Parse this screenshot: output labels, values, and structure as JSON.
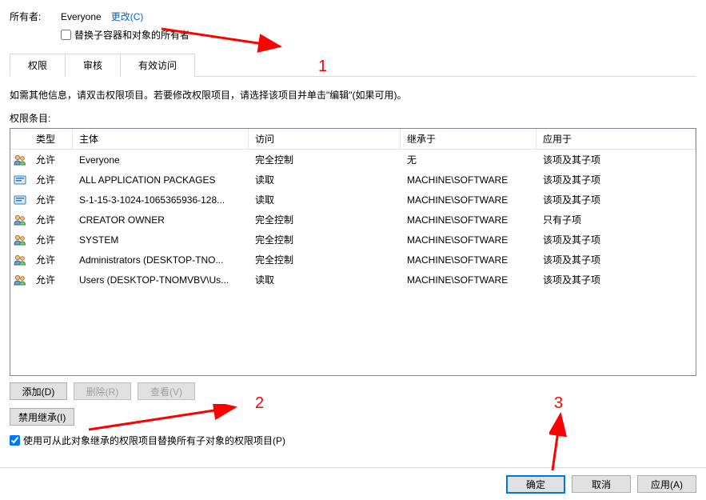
{
  "owner": {
    "label": "所有者:",
    "value": "Everyone",
    "change_link": "更改(C)",
    "replace_checkbox_label": "替换子容器和对象的所有者"
  },
  "tabs": {
    "permissions": "权限",
    "auditing": "审核",
    "effective_access": "有效访问"
  },
  "info_text": "如需其他信息，请双击权限项目。若要修改权限项目，请选择该项目并单击\"编辑\"(如果可用)。",
  "entries_label": "权限条目:",
  "columns": {
    "type": "类型",
    "principal": "主体",
    "access": "访问",
    "inherit": "继承于",
    "apply": "应用于"
  },
  "rows": [
    {
      "icon": "users",
      "type": "允许",
      "principal": "Everyone",
      "access": "完全控制",
      "inherit": "无",
      "apply": "该项及其子项"
    },
    {
      "icon": "pkg",
      "type": "允许",
      "principal": "ALL APPLICATION PACKAGES",
      "access": "读取",
      "inherit": "MACHINE\\SOFTWARE",
      "apply": "该项及其子项"
    },
    {
      "icon": "pkg",
      "type": "允许",
      "principal": "S-1-15-3-1024-1065365936-128...",
      "access": "读取",
      "inherit": "MACHINE\\SOFTWARE",
      "apply": "该项及其子项"
    },
    {
      "icon": "users",
      "type": "允许",
      "principal": "CREATOR OWNER",
      "access": "完全控制",
      "inherit": "MACHINE\\SOFTWARE",
      "apply": "只有子项"
    },
    {
      "icon": "users",
      "type": "允许",
      "principal": "SYSTEM",
      "access": "完全控制",
      "inherit": "MACHINE\\SOFTWARE",
      "apply": "该项及其子项"
    },
    {
      "icon": "users",
      "type": "允许",
      "principal": "Administrators (DESKTOP-TNO...",
      "access": "完全控制",
      "inherit": "MACHINE\\SOFTWARE",
      "apply": "该项及其子项"
    },
    {
      "icon": "users",
      "type": "允许",
      "principal": "Users (DESKTOP-TNOMVBV\\Us...",
      "access": "读取",
      "inherit": "MACHINE\\SOFTWARE",
      "apply": "该项及其子项"
    }
  ],
  "buttons": {
    "add": "添加(D)",
    "remove": "删除(R)",
    "view": "查看(V)",
    "disable_inherit": "禁用继承(I)",
    "ok": "确定",
    "cancel": "取消",
    "apply": "应用(A)"
  },
  "replace_perms_label": "使用可从此对象继承的权限项目替换所有子对象的权限项目(P)",
  "annotations": {
    "a1": "1",
    "a2": "2",
    "a3": "3"
  }
}
